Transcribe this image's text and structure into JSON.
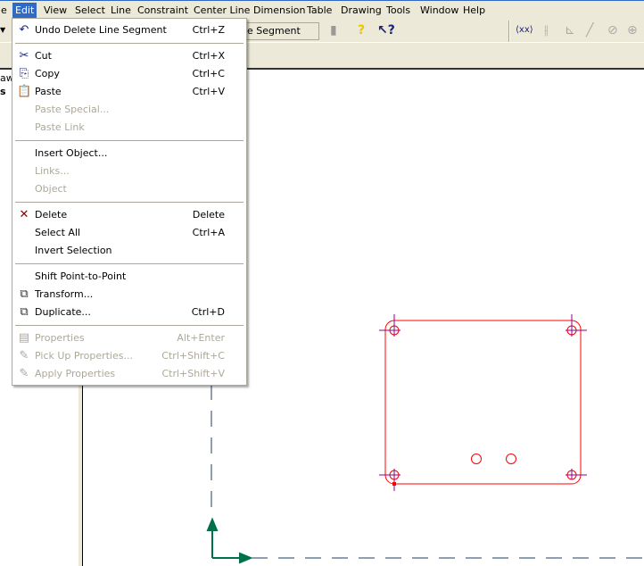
{
  "menubar": {
    "items": [
      "e",
      "Edit",
      "View",
      "Select",
      "Line",
      "Constraint",
      "Center Line",
      "Dimension",
      "Table",
      "Drawing",
      "Tools",
      "Window",
      "Help"
    ],
    "active": "Edit"
  },
  "toolbar": {
    "combo_text": "e Segment",
    "icons": [
      "scroll-icon",
      "help-icon",
      "context-help-icon",
      "dimension-xx-icon",
      "parallel-icon",
      "perpendicular-icon",
      "line-icon",
      "tangent-icon",
      "concentric-icon"
    ]
  },
  "left_panel": {
    "text1": "awi",
    "text2": "s"
  },
  "edit_menu": {
    "items": [
      {
        "label": "Undo Delete Line Segment",
        "shortcut": "Ctrl+Z",
        "enabled": true,
        "icon": "undo-icon"
      },
      {
        "sep": true
      },
      {
        "label": "Cut",
        "shortcut": "Ctrl+X",
        "enabled": true,
        "icon": "scissors-icon"
      },
      {
        "label": "Copy",
        "shortcut": "Ctrl+C",
        "enabled": true,
        "icon": "copy-icon"
      },
      {
        "label": "Paste",
        "shortcut": "Ctrl+V",
        "enabled": true,
        "icon": "paste-icon"
      },
      {
        "label": "Paste Special...",
        "shortcut": "",
        "enabled": false
      },
      {
        "label": "Paste Link",
        "shortcut": "",
        "enabled": false
      },
      {
        "sep": true
      },
      {
        "label": "Insert Object...",
        "shortcut": "",
        "enabled": true
      },
      {
        "label": "Links...",
        "shortcut": "",
        "enabled": false
      },
      {
        "label": "Object",
        "shortcut": "",
        "enabled": false
      },
      {
        "sep": true
      },
      {
        "label": "Delete",
        "shortcut": "Delete",
        "enabled": true,
        "icon": "delete-x-icon"
      },
      {
        "label": "Select All",
        "shortcut": "Ctrl+A",
        "enabled": true
      },
      {
        "label": "Invert Selection",
        "shortcut": "",
        "enabled": true
      },
      {
        "sep": true
      },
      {
        "label": "Shift Point-to-Point",
        "shortcut": "",
        "enabled": true
      },
      {
        "label": "Transform...",
        "shortcut": "",
        "enabled": true,
        "icon": "transform-icon"
      },
      {
        "label": "Duplicate...",
        "shortcut": "Ctrl+D",
        "enabled": true,
        "icon": "duplicate-icon"
      },
      {
        "sep": true
      },
      {
        "label": "Properties",
        "shortcut": "Alt+Enter",
        "enabled": false,
        "icon": "properties-icon"
      },
      {
        "label": "Pick Up Properties...",
        "shortcut": "Ctrl+Shift+C",
        "enabled": false,
        "icon": "eyedropper-icon"
      },
      {
        "label": "Apply Properties",
        "shortcut": "Ctrl+Shift+V",
        "enabled": false,
        "icon": "apply-properties-icon"
      }
    ]
  },
  "colors": {
    "sketch": "#ff0000",
    "constraint": "#8b008b",
    "axis": "#00704a",
    "centerline": "#1f3f5f",
    "menu_highlight": "#316ac5"
  }
}
